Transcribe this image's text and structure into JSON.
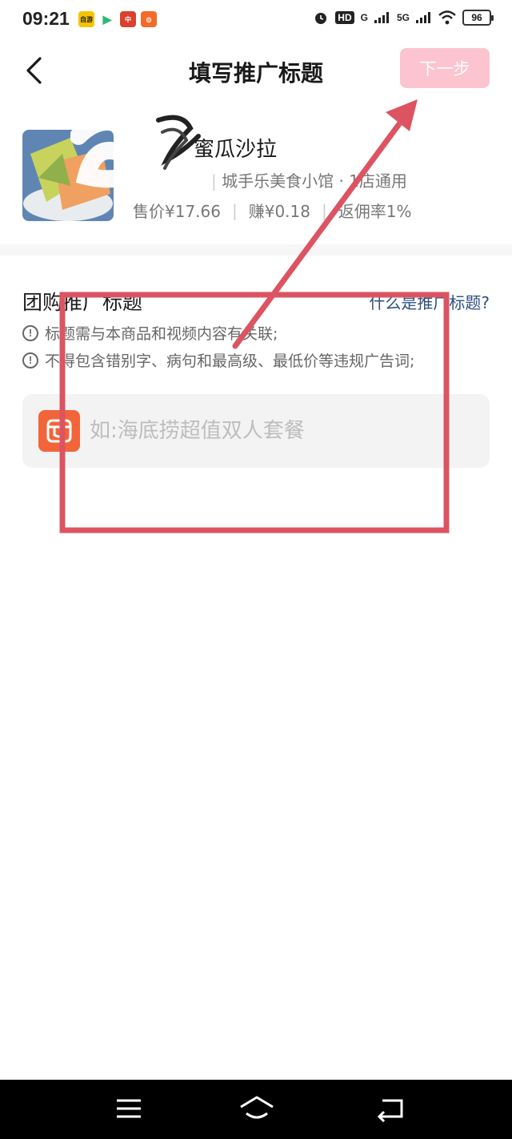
{
  "status_bar": {
    "time": "09:21",
    "app_icons": [
      {
        "name": "app-icon-yellow",
        "label": "自游",
        "color": "#f5c400"
      },
      {
        "name": "app-icon-play",
        "label": "▶",
        "color": "#2eb872"
      },
      {
        "name": "app-icon-red",
        "label": "中",
        "color": "#d9412e"
      },
      {
        "name": "app-icon-orange",
        "label": "◎",
        "color": "#f26b2a"
      }
    ],
    "hd": "HD",
    "net1": "G",
    "net2": "5G",
    "battery": "96"
  },
  "header": {
    "title": "填写推广标题",
    "next_label": "下一步"
  },
  "product": {
    "name": "蜜瓜沙拉",
    "store": "城手乐美食小馆 · 1店通用",
    "price": "售价¥17.66",
    "earn": "赚¥0.18",
    "commission": "返佣率1%"
  },
  "section": {
    "title": "团购推广标题",
    "help_link": "什么是推广标题?",
    "tips": [
      "标题需与本商品和视频内容有关联;",
      "不得包含错别字、病句和最高级、最低价等违规广告词;"
    ],
    "tip_icon": "!"
  },
  "input": {
    "placeholder": "如:海底捞超值双人套餐",
    "value": ""
  },
  "colors": {
    "next_button": "#fcc4cf",
    "annotation": "#dc5462",
    "link": "#2f4f7f",
    "logo": "#f2643a"
  },
  "icons": {
    "back": "chevron-left-icon",
    "menu": "menu-icon",
    "home": "home-icon",
    "return": "return-icon",
    "alarm": "alarm-icon",
    "wifi": "wifi-icon"
  }
}
